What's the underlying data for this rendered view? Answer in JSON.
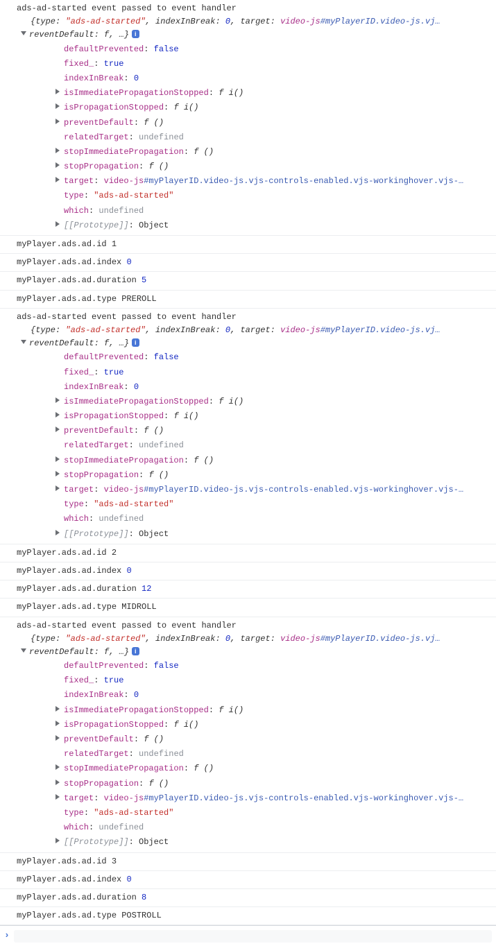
{
  "groups": [
    {
      "header": "ads-ad-started event passed to event handler",
      "summary_pre": "{type: ",
      "summary_type": "\"ads-ad-started\"",
      "summary_mid": ", indexInBreak: ",
      "summary_idx": "0",
      "summary_tgt_lbl": ", target: ",
      "summary_tgt_el": "video-js",
      "summary_tgt_sel": "#myPlayerID.video-js.vj…",
      "summary_line2": "reventDefault: f, …}",
      "props": [
        {
          "tri": false,
          "key": "defaultPrevented",
          "vtype": "kw",
          "val": "false"
        },
        {
          "tri": false,
          "key": "fixed_",
          "vtype": "kw",
          "val": "true"
        },
        {
          "tri": false,
          "key": "indexInBreak",
          "vtype": "num",
          "val": "0"
        },
        {
          "tri": true,
          "key": "isImmediatePropagationStopped",
          "vtype": "fn",
          "val": "f i()"
        },
        {
          "tri": true,
          "key": "isPropagationStopped",
          "vtype": "fn",
          "val": "f i()"
        },
        {
          "tri": true,
          "key": "preventDefault",
          "vtype": "fn",
          "val": "f ()"
        },
        {
          "tri": false,
          "key": "relatedTarget",
          "vtype": "undef",
          "val": "undefined"
        },
        {
          "tri": true,
          "key": "stopImmediatePropagation",
          "vtype": "fn",
          "val": "f ()"
        },
        {
          "tri": true,
          "key": "stopPropagation",
          "vtype": "fn",
          "val": "f ()"
        },
        {
          "tri": true,
          "key": "target",
          "vtype": "target",
          "val_el": "video-js",
          "val_sel": "#myPlayerID.video-js.vjs-controls-enabled.vjs-workinghover.vjs-…"
        },
        {
          "tri": false,
          "key": "type",
          "vtype": "str",
          "val": "\"ads-ad-started\""
        },
        {
          "tri": false,
          "key": "which",
          "vtype": "undef",
          "val": "undefined"
        },
        {
          "tri": true,
          "key": "[[Prototype]]",
          "vtype": "protoval",
          "val": "Object",
          "keyclass": "proto"
        }
      ],
      "afterRows": [
        {
          "label": "myPlayer.ads.ad.id ",
          "vtype": "msg",
          "val": "1"
        },
        {
          "label": "myPlayer.ads.ad.index ",
          "vtype": "num",
          "val": "0"
        },
        {
          "label": "myPlayer.ads.ad.duration ",
          "vtype": "num",
          "val": "5"
        },
        {
          "label": "myPlayer.ads.ad.type ",
          "vtype": "msg",
          "val": "PREROLL"
        }
      ]
    },
    {
      "header": "ads-ad-started event passed to event handler",
      "summary_pre": "{type: ",
      "summary_type": "\"ads-ad-started\"",
      "summary_mid": ", indexInBreak: ",
      "summary_idx": "0",
      "summary_tgt_lbl": ", target: ",
      "summary_tgt_el": "video-js",
      "summary_tgt_sel": "#myPlayerID.video-js.vj…",
      "summary_line2": "reventDefault: f, …}",
      "props": [
        {
          "tri": false,
          "key": "defaultPrevented",
          "vtype": "kw",
          "val": "false"
        },
        {
          "tri": false,
          "key": "fixed_",
          "vtype": "kw",
          "val": "true"
        },
        {
          "tri": false,
          "key": "indexInBreak",
          "vtype": "num",
          "val": "0"
        },
        {
          "tri": true,
          "key": "isImmediatePropagationStopped",
          "vtype": "fn",
          "val": "f i()"
        },
        {
          "tri": true,
          "key": "isPropagationStopped",
          "vtype": "fn",
          "val": "f i()"
        },
        {
          "tri": true,
          "key": "preventDefault",
          "vtype": "fn",
          "val": "f ()"
        },
        {
          "tri": false,
          "key": "relatedTarget",
          "vtype": "undef",
          "val": "undefined"
        },
        {
          "tri": true,
          "key": "stopImmediatePropagation",
          "vtype": "fn",
          "val": "f ()"
        },
        {
          "tri": true,
          "key": "stopPropagation",
          "vtype": "fn",
          "val": "f ()"
        },
        {
          "tri": true,
          "key": "target",
          "vtype": "target",
          "val_el": "video-js",
          "val_sel": "#myPlayerID.video-js.vjs-controls-enabled.vjs-workinghover.vjs-…"
        },
        {
          "tri": false,
          "key": "type",
          "vtype": "str",
          "val": "\"ads-ad-started\""
        },
        {
          "tri": false,
          "key": "which",
          "vtype": "undef",
          "val": "undefined"
        },
        {
          "tri": true,
          "key": "[[Prototype]]",
          "vtype": "protoval",
          "val": "Object",
          "keyclass": "proto"
        }
      ],
      "afterRows": [
        {
          "label": "myPlayer.ads.ad.id ",
          "vtype": "msg",
          "val": "2"
        },
        {
          "label": "myPlayer.ads.ad.index ",
          "vtype": "num",
          "val": "0"
        },
        {
          "label": "myPlayer.ads.ad.duration ",
          "vtype": "num",
          "val": "12"
        },
        {
          "label": "myPlayer.ads.ad.type ",
          "vtype": "msg",
          "val": "MIDROLL"
        }
      ]
    },
    {
      "header": "ads-ad-started event passed to event handler",
      "summary_pre": "{type: ",
      "summary_type": "\"ads-ad-started\"",
      "summary_mid": ", indexInBreak: ",
      "summary_idx": "0",
      "summary_tgt_lbl": ", target: ",
      "summary_tgt_el": "video-js",
      "summary_tgt_sel": "#myPlayerID.video-js.vj…",
      "summary_line2": "reventDefault: f, …}",
      "props": [
        {
          "tri": false,
          "key": "defaultPrevented",
          "vtype": "kw",
          "val": "false"
        },
        {
          "tri": false,
          "key": "fixed_",
          "vtype": "kw",
          "val": "true"
        },
        {
          "tri": false,
          "key": "indexInBreak",
          "vtype": "num",
          "val": "0"
        },
        {
          "tri": true,
          "key": "isImmediatePropagationStopped",
          "vtype": "fn",
          "val": "f i()"
        },
        {
          "tri": true,
          "key": "isPropagationStopped",
          "vtype": "fn",
          "val": "f i()"
        },
        {
          "tri": true,
          "key": "preventDefault",
          "vtype": "fn",
          "val": "f ()"
        },
        {
          "tri": false,
          "key": "relatedTarget",
          "vtype": "undef",
          "val": "undefined"
        },
        {
          "tri": true,
          "key": "stopImmediatePropagation",
          "vtype": "fn",
          "val": "f ()"
        },
        {
          "tri": true,
          "key": "stopPropagation",
          "vtype": "fn",
          "val": "f ()"
        },
        {
          "tri": true,
          "key": "target",
          "vtype": "target",
          "val_el": "video-js",
          "val_sel": "#myPlayerID.video-js.vjs-controls-enabled.vjs-workinghover.vjs-…"
        },
        {
          "tri": false,
          "key": "type",
          "vtype": "str",
          "val": "\"ads-ad-started\""
        },
        {
          "tri": false,
          "key": "which",
          "vtype": "undef",
          "val": "undefined"
        },
        {
          "tri": true,
          "key": "[[Prototype]]",
          "vtype": "protoval",
          "val": "Object",
          "keyclass": "proto"
        }
      ],
      "afterRows": [
        {
          "label": "myPlayer.ads.ad.id ",
          "vtype": "msg",
          "val": "3"
        },
        {
          "label": "myPlayer.ads.ad.index ",
          "vtype": "num",
          "val": "0"
        },
        {
          "label": "myPlayer.ads.ad.duration ",
          "vtype": "num",
          "val": "8"
        },
        {
          "label": "myPlayer.ads.ad.type ",
          "vtype": "msg",
          "val": "POSTROLL"
        }
      ]
    }
  ],
  "info_badge": "i",
  "prompt": ""
}
